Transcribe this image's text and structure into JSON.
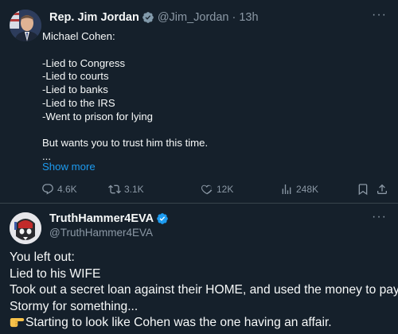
{
  "tweet": {
    "author_name": "Rep. Jim Jordan",
    "handle": "@Jim_Jordan",
    "separator": "·",
    "time": "13h",
    "lines": [
      "Michael Cohen:",
      "",
      "-Lied to Congress",
      "-Lied to courts",
      "-Lied to banks",
      "-Lied to the IRS",
      "-Went to prison for lying",
      "",
      "But wants you to trust him this time.",
      "..."
    ],
    "show_more": "Show more",
    "stats": {
      "replies": "4.6K",
      "retweets": "3.1K",
      "likes": "12K",
      "views": "248K"
    }
  },
  "reply": {
    "author_name": "TruthHammer4EVA",
    "handle": "@TruthHammer4EVA",
    "lines": [
      "You left out:",
      "Lied to his WIFE",
      "Took out a secret loan against their HOME, and used the money to pay",
      "Stormy for something...",
      "Starting to look like Cohen was the one having an affair."
    ]
  },
  "icons": {
    "verified": "verified-badge-icon",
    "more": "more-icon",
    "reply": "reply-icon",
    "retweet": "retweet-icon",
    "like": "like-icon",
    "views": "views-icon",
    "bookmark": "bookmark-icon",
    "share": "share-icon",
    "pointing": "pointing-hand-emoji"
  },
  "colors": {
    "background": "#15202b",
    "text": "#f7f9f9",
    "muted": "#8b98a5",
    "accent": "#1d9bf0",
    "divider": "#38444d"
  }
}
